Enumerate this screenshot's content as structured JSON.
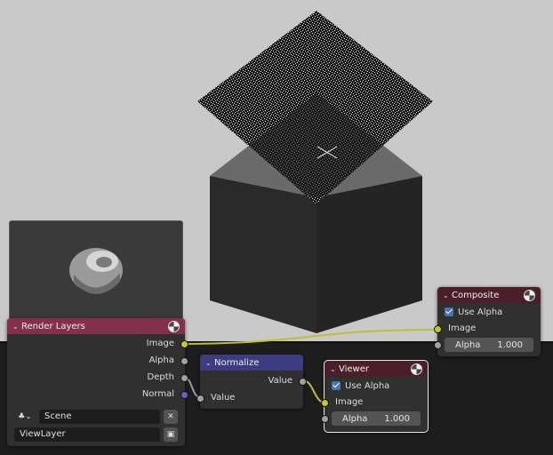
{
  "nodes": {
    "render_layers": {
      "title": "Render Layers",
      "header_color": "#83314a",
      "outputs": [
        "Image",
        "Alpha",
        "Depth",
        "Normal"
      ],
      "scene": "Scene",
      "view_layer": "ViewLayer"
    },
    "normalize": {
      "title": "Normalize",
      "header_color": "#3c3c83",
      "output": "Value",
      "input": "Value"
    },
    "viewer": {
      "title": "Viewer",
      "header_color": "#4b1f29",
      "use_alpha_label": "Use Alpha",
      "input": "Image",
      "alpha_label": "Alpha",
      "alpha_value": "1.000"
    },
    "composite": {
      "title": "Composite",
      "header_color": "#4b1f29",
      "use_alpha_label": "Use Alpha",
      "input": "Image",
      "alpha_label": "Alpha",
      "alpha_value": "1.000"
    }
  },
  "icons": {
    "header_icon": "compositor-sphere-icon",
    "checkbox": "checkmark-icon",
    "scene_icon": "scene-icon",
    "clear": "close-icon",
    "browse": "browse-icon"
  }
}
